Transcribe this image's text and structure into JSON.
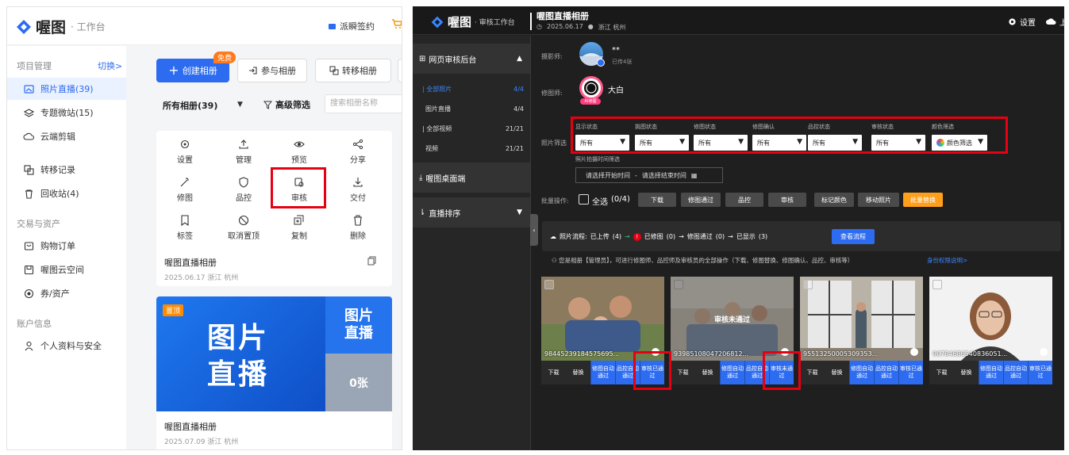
{
  "left": {
    "brand": {
      "name": "喔图",
      "sub": "· 工作台"
    },
    "header": {
      "sign_label": "派瞬签约"
    },
    "sidebar": {
      "section1": "项目管理",
      "switch": "切换>",
      "items1": [
        {
          "label": "照片直播(39)",
          "icon": "image-icon"
        },
        {
          "label": "专题微站(15)",
          "icon": "layers-icon"
        },
        {
          "label": "云端剪辑",
          "icon": "cloud-icon"
        },
        {
          "label": "转移记录",
          "icon": "transfer-icon"
        },
        {
          "label": "回收站(4)",
          "icon": "trash-icon"
        }
      ],
      "section2": "交易与资产",
      "items2": [
        {
          "label": "购物订单",
          "icon": "order-icon"
        },
        {
          "label": "喔图云空间",
          "icon": "storage-icon"
        },
        {
          "label": "券/资产",
          "icon": "coupon-icon"
        }
      ],
      "section3": "账户信息",
      "items3": [
        {
          "label": "个人资料与安全",
          "icon": "user-icon"
        }
      ]
    },
    "toolbar": {
      "create": "创建相册",
      "free_badge": "免费",
      "join": "参与相册",
      "transfer": "转移相册",
      "all_albums": "所有相册(39)",
      "advanced_filter": "高级筛选",
      "search_placeholder": "搜索相册名称"
    },
    "card1": {
      "actions": [
        {
          "label": "设置",
          "icon": "gear-icon"
        },
        {
          "label": "管理",
          "icon": "upload-icon"
        },
        {
          "label": "预览",
          "icon": "eye-icon"
        },
        {
          "label": "分享",
          "icon": "share-icon"
        },
        {
          "label": "修图",
          "icon": "wand-icon"
        },
        {
          "label": "品控",
          "icon": "shield-icon"
        },
        {
          "label": "审核",
          "icon": "review-icon"
        },
        {
          "label": "交付",
          "icon": "download-icon"
        },
        {
          "label": "标签",
          "icon": "bookmark-icon"
        },
        {
          "label": "取消置顶",
          "icon": "unpin-icon"
        },
        {
          "label": "复制",
          "icon": "copy-plus-icon"
        },
        {
          "label": "删除",
          "icon": "trash-icon"
        }
      ],
      "title": "喔图直播相册",
      "meta": "2025.06.17 浙江 杭州"
    },
    "card2": {
      "badge": "置顶",
      "cover_text_1": "图片",
      "cover_text_2": "直播",
      "side_text_1": "图片",
      "side_text_2": "直播",
      "count": "0张",
      "title": "喔图直播相册",
      "meta": "2025.07.09 浙江 杭州"
    }
  },
  "right": {
    "brand": {
      "name": "喔图",
      "sub": "· 审核工作台"
    },
    "album_title": "喔图直播相册",
    "album_date": "2025.06.17",
    "album_location": "浙江 杭州",
    "settings": "设置",
    "upload": "上",
    "sidebar": {
      "section1": "网页审核后台",
      "items": [
        {
          "label": "| 全部照片",
          "count": "4/4"
        },
        {
          "label": "图片直播",
          "count": "4/4"
        },
        {
          "label": "| 全部视频",
          "count": "21/21"
        },
        {
          "label": "视频",
          "count": "21/21"
        }
      ],
      "section2": "喔图桌面端",
      "section3": "直播排序"
    },
    "photographer": {
      "label": "摄影师:",
      "name": "**",
      "uploaded": "已传4张"
    },
    "retoucher": {
      "label": "修图师:",
      "name": "大白",
      "badge": "AI修图"
    },
    "filters": {
      "label": "照片筛选",
      "groups": [
        {
          "head": "显示状态",
          "value": "所有"
        },
        {
          "head": "挑图状态",
          "value": "所有"
        },
        {
          "head": "修图状态",
          "value": "所有"
        },
        {
          "head": "修图确认",
          "value": "所有"
        },
        {
          "head": "品控状态",
          "value": "所有"
        },
        {
          "head": "审核状态",
          "value": "所有"
        },
        {
          "head": "颜色筛选",
          "value": "颜色筛选"
        }
      ],
      "time_label": "照片拍摄时间筛选",
      "time_start": "请选择开始时间",
      "time_sep": "-",
      "time_end": "请选择结束时间"
    },
    "batch": {
      "label": "批量操作:",
      "select_all": "全选",
      "selected": "(0/4)",
      "buttons": [
        "下载",
        "修图通过",
        "品控",
        "审核",
        "标记颜色",
        "移动照片",
        "批量替换"
      ]
    },
    "flow": {
      "title": "照片流程:",
      "step1": "已上传",
      "step1_count": "(4)",
      "step2": "已修图",
      "step2_count": "(0)",
      "step3": "修图通过",
      "step3_count": "(0)",
      "step4": "已显示",
      "step4_count": "(3)",
      "view_button": "查看流程",
      "role_text": "您是相册【管理员】，可进行修图师、品控师及审核员的全部操作（下载、修图替换、修图确认、品控、审核等）",
      "role_link": "身份权限说明>"
    },
    "photos": [
      {
        "id": "98445239184575695...",
        "overlay": "",
        "buttons": [
          "下载",
          "替换",
          "修图自动通过",
          "品控自动通过",
          "审核已通过"
        ]
      },
      {
        "id": "93985108047206812...",
        "overlay": "审核未通过",
        "buttons": [
          "下载",
          "替换",
          "修图自动通过",
          "品控自动通过",
          "审核未通过"
        ]
      },
      {
        "id": "95513250005309353...",
        "overlay": "",
        "buttons": [
          "下载",
          "替换",
          "修图自动通过",
          "品控自动通过",
          "审核已通过"
        ]
      },
      {
        "id": "90784686540836051...",
        "overlay": "",
        "buttons": [
          "下载",
          "替换",
          "修图自动通过",
          "品控自动通过",
          "审核已通过"
        ]
      }
    ]
  },
  "colors": {
    "accent": "#2d6cf0",
    "highlight": "#e60012",
    "orange": "#ff8a00",
    "dark_bg": "#1f1f1f"
  }
}
